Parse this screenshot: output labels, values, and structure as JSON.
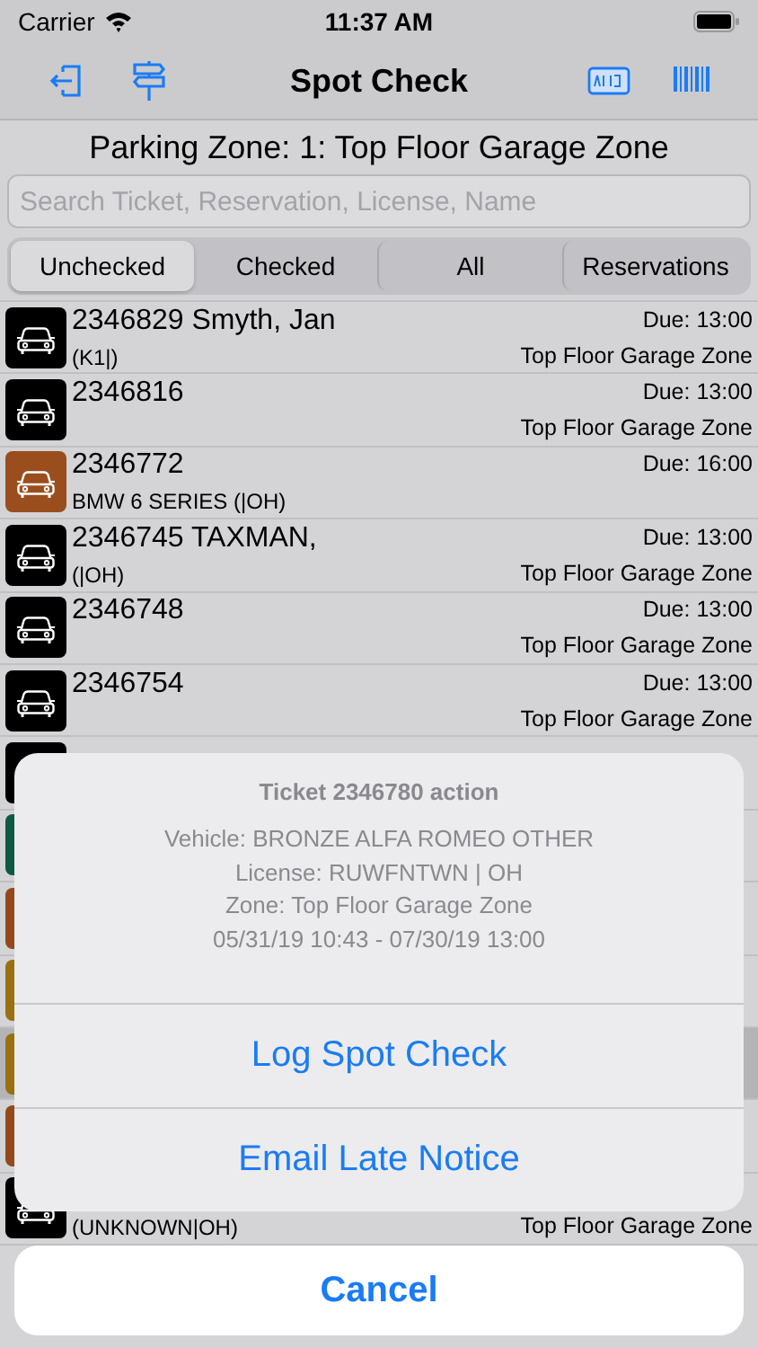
{
  "status_bar": {
    "carrier": "Carrier",
    "time": "11:37 AM"
  },
  "nav": {
    "title": "Spot Check"
  },
  "zone_title": "Parking Zone: 1: Top Floor Garage Zone",
  "search": {
    "placeholder": "Search Ticket, Reservation, License, Name"
  },
  "segments": [
    {
      "label": "Unchecked",
      "selected": true
    },
    {
      "label": "Checked",
      "selected": false
    },
    {
      "label": "All",
      "selected": false
    },
    {
      "label": "Reservations",
      "selected": false
    }
  ],
  "tickets": [
    {
      "title": "2346829 Smyth, Jan",
      "detail": "(K1|)",
      "due": "Due: 13:00",
      "zone": "Top Floor Garage Zone",
      "color": "#000000",
      "selected": false
    },
    {
      "title": "2346816",
      "due": "Due: 13:00",
      "zone": "Top Floor Garage Zone",
      "color": "#000000",
      "selected": false
    },
    {
      "title": "2346772",
      "detail": "BMW 6 SERIES (|OH)",
      "due": "Due: 16:00",
      "color": "#9a4e1e",
      "selected": false
    },
    {
      "title": "2346745 TAXMAN,",
      "detail": "(|OH)",
      "due": "Due: 13:00",
      "zone": "Top Floor Garage Zone",
      "color": "#000000",
      "selected": false
    },
    {
      "title": "2346748",
      "due": "Due: 13:00",
      "zone": "Top Floor Garage Zone",
      "color": "#000000",
      "selected": false
    },
    {
      "title": "2346754",
      "due": "Due: 13:00",
      "zone": "Top Floor Garage Zone",
      "color": "#000000",
      "selected": false
    },
    {
      "color": "#000000",
      "selected": false
    },
    {
      "color": "#0e5a40",
      "selected": false
    },
    {
      "color": "#94481c",
      "selected": false
    },
    {
      "color": "#98700e",
      "selected": false
    },
    {
      "color": "#98700e",
      "selected": true
    },
    {
      "color": "#94481c",
      "selected": false
    },
    {
      "detail": "(UNKNOWN|OH)",
      "zone": "Top Floor Garage Zone",
      "color": "#000000",
      "selected": false
    }
  ],
  "action_sheet": {
    "title": "Ticket 2346780 action",
    "message_lines": [
      "Vehicle: BRONZE ALFA ROMEO OTHER",
      "License: RUWFNTWN | OH",
      "Zone: Top Floor Garage Zone",
      "05/31/19 10:43 - 07/30/19 13:00"
    ],
    "actions": [
      "Log Spot Check",
      "Email Late Notice"
    ],
    "cancel": "Cancel"
  }
}
